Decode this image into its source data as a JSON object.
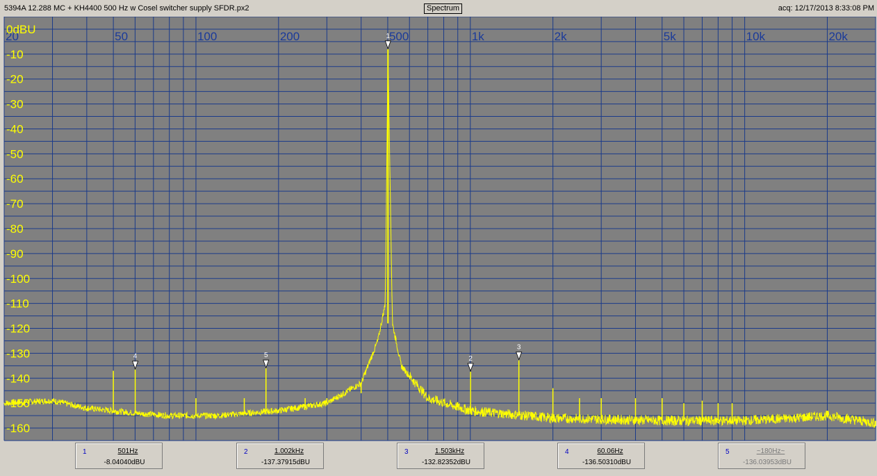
{
  "window": {
    "file_title": "5394A 12.288 MC + KH4400 500 Hz w Cosel switcher supply SFDR.px2",
    "tab_label": "Spectrum",
    "acquired": "acq: 12/17/2013 8:33:08 PM"
  },
  "chart_data": {
    "type": "line",
    "title": "",
    "xlabel": "",
    "ylabel": "",
    "x_scale": "log",
    "xlim": [
      20,
      30000
    ],
    "ylim": [
      -165,
      5
    ],
    "grid": true,
    "x_ticks": [
      {
        "value": 20,
        "label": "20"
      },
      {
        "value": 50,
        "label": "50"
      },
      {
        "value": 100,
        "label": "100"
      },
      {
        "value": 200,
        "label": "200"
      },
      {
        "value": 500,
        "label": "500"
      },
      {
        "value": 1000,
        "label": "1k"
      },
      {
        "value": 2000,
        "label": "2k"
      },
      {
        "value": 5000,
        "label": "5k"
      },
      {
        "value": 10000,
        "label": "10k"
      },
      {
        "value": 20000,
        "label": "20k"
      }
    ],
    "y_ticks": [
      {
        "value": 0,
        "label": "0dBU"
      },
      {
        "value": -10,
        "label": "-10"
      },
      {
        "value": -20,
        "label": "-20"
      },
      {
        "value": -30,
        "label": "-30"
      },
      {
        "value": -40,
        "label": "-40"
      },
      {
        "value": -50,
        "label": "-50"
      },
      {
        "value": -60,
        "label": "-60"
      },
      {
        "value": -70,
        "label": "-70"
      },
      {
        "value": -80,
        "label": "-80"
      },
      {
        "value": -90,
        "label": "-90"
      },
      {
        "value": -100,
        "label": "-100"
      },
      {
        "value": -110,
        "label": "-110"
      },
      {
        "value": -120,
        "label": "-120"
      },
      {
        "value": -130,
        "label": "-130"
      },
      {
        "value": -140,
        "label": "-140"
      },
      {
        "value": -150,
        "label": "-150"
      },
      {
        "value": -160,
        "label": "-160"
      }
    ],
    "series": [
      {
        "color": "#ffff00",
        "noise_floor": [
          [
            20,
            -150
          ],
          [
            30,
            -149
          ],
          [
            40,
            -152
          ],
          [
            60,
            -154
          ],
          [
            80,
            -155
          ],
          [
            120,
            -155
          ],
          [
            200,
            -153
          ],
          [
            300,
            -150
          ],
          [
            400,
            -142
          ],
          [
            460,
            -125
          ],
          [
            490,
            -110
          ],
          [
            501,
            -8
          ],
          [
            520,
            -118
          ],
          [
            560,
            -135
          ],
          [
            700,
            -148
          ],
          [
            1000,
            -153
          ],
          [
            2000,
            -156
          ],
          [
            5000,
            -157
          ],
          [
            10000,
            -157
          ],
          [
            15000,
            -156
          ],
          [
            20000,
            -155
          ],
          [
            30000,
            -158
          ]
        ],
        "spurs": [
          [
            50,
            -137
          ],
          [
            60.06,
            -136.5
          ],
          [
            100,
            -148
          ],
          [
            150,
            -148
          ],
          [
            180,
            -136.04
          ],
          [
            250,
            -148
          ],
          [
            300,
            -148
          ],
          [
            350,
            -146
          ],
          [
            400,
            -146
          ],
          [
            1002,
            -137.38
          ],
          [
            1503,
            -132.82
          ],
          [
            2000,
            -144
          ],
          [
            2500,
            -148
          ],
          [
            3000,
            -148
          ],
          [
            4000,
            -148
          ],
          [
            5000,
            -148
          ],
          [
            6000,
            -150
          ],
          [
            7000,
            -149
          ],
          [
            8000,
            -150
          ],
          [
            9000,
            -150
          ]
        ]
      }
    ],
    "markers": [
      {
        "id": "1",
        "freq_label": "501Hz",
        "level_label": "-8.04040dBU",
        "x": 501,
        "y": -8.04,
        "active": true
      },
      {
        "id": "2",
        "freq_label": "1.002kHz",
        "level_label": "-137.37915dBU",
        "x": 1002,
        "y": -137.38,
        "active": true
      },
      {
        "id": "3",
        "freq_label": "1.503kHz",
        "level_label": "-132.82352dBU",
        "x": 1503,
        "y": -132.82,
        "active": true
      },
      {
        "id": "4",
        "freq_label": "60.06Hz",
        "level_label": "-136.50310dBU",
        "x": 60.06,
        "y": -136.5,
        "active": true
      },
      {
        "id": "5",
        "freq_label": "~180Hz~",
        "level_label": "-136.03953dBU",
        "x": 180,
        "y": -136.04,
        "active": false
      }
    ],
    "colors": {
      "background": "#808080",
      "grid": "#1a3a8a",
      "trace": "#ffff00",
      "x_tick_text": "#1a3a9a",
      "y_tick_text": "#ffff00"
    }
  }
}
